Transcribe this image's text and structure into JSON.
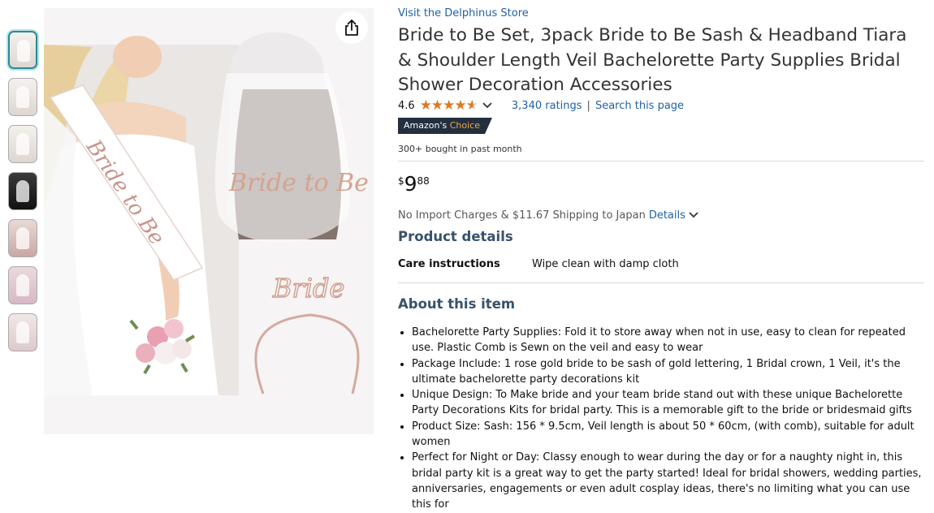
{
  "thumbnails": [
    "Sash, headband and veil set",
    "Bride wearing sash",
    "Veil",
    "Headband",
    "Veil on bride",
    "Bridal party",
    "Set contents"
  ],
  "store_link": "Visit the Delphinus Store",
  "title": "Bride to Be Set, 3pack Bride to Be Sash & Headband Tiara & Shoulder Length Veil Bachelorette Party Supplies Bridal Shower Decoration Accessories",
  "rating": {
    "value": "4.6",
    "stars": 4.6,
    "ratings_text": "3,340 ratings",
    "separator": "|",
    "search_text": "Search this page"
  },
  "badge": {
    "prefix": "Amazon's",
    "suffix": "Choice"
  },
  "bought": "300+ bought in past month",
  "price": {
    "currency": "$",
    "whole": "9",
    "fraction": "88"
  },
  "shipping": {
    "text": "No Import Charges & $11.67 Shipping to Japan",
    "details": "Details"
  },
  "product_details": {
    "heading": "Product details",
    "rows": [
      {
        "label": "Care instructions",
        "value": "Wipe clean with damp cloth"
      }
    ]
  },
  "about": {
    "heading": "About this item",
    "bullets": [
      "Bachelorette Party Supplies: Fold it to store away when not in use, easy to clean for repeated use. Plastic Comb is Sewn on the veil and easy to wear",
      "Package Include: 1 rose gold bride to be sash of gold lettering, 1 Bridal crown, 1 Veil, it's the ultimate bachelorette party decorations kit",
      "Unique Design: To Make bride and your team bride stand out with these unique Bachelorette Party Decorations Kits for bridal party. This is a memorable gift to the bride or bridesmaid gifts",
      "Product Size: Sash: 156 * 9.5cm, Veil length is about 50 * 60cm, (with comb), suitable for adult women",
      "Perfect for Night or Day: Classy enough to wear during the day or for a naughty night in, this bridal party kit is a great way to get the party started! Ideal for bridal showers, wedding parties, anniversaries, engagements or even adult cosplay ideas, there's no limiting what you can use this for"
    ]
  },
  "image_text": {
    "sash_text": "Bride to Be",
    "veil_text": "Bride to Be",
    "tiara_text": "Bride"
  },
  "colors": {
    "link": "#2162a1",
    "star": "#de7921",
    "badge_bg": "#232f3e",
    "badge_accent": "#f3a847",
    "heading": "#37526b"
  }
}
